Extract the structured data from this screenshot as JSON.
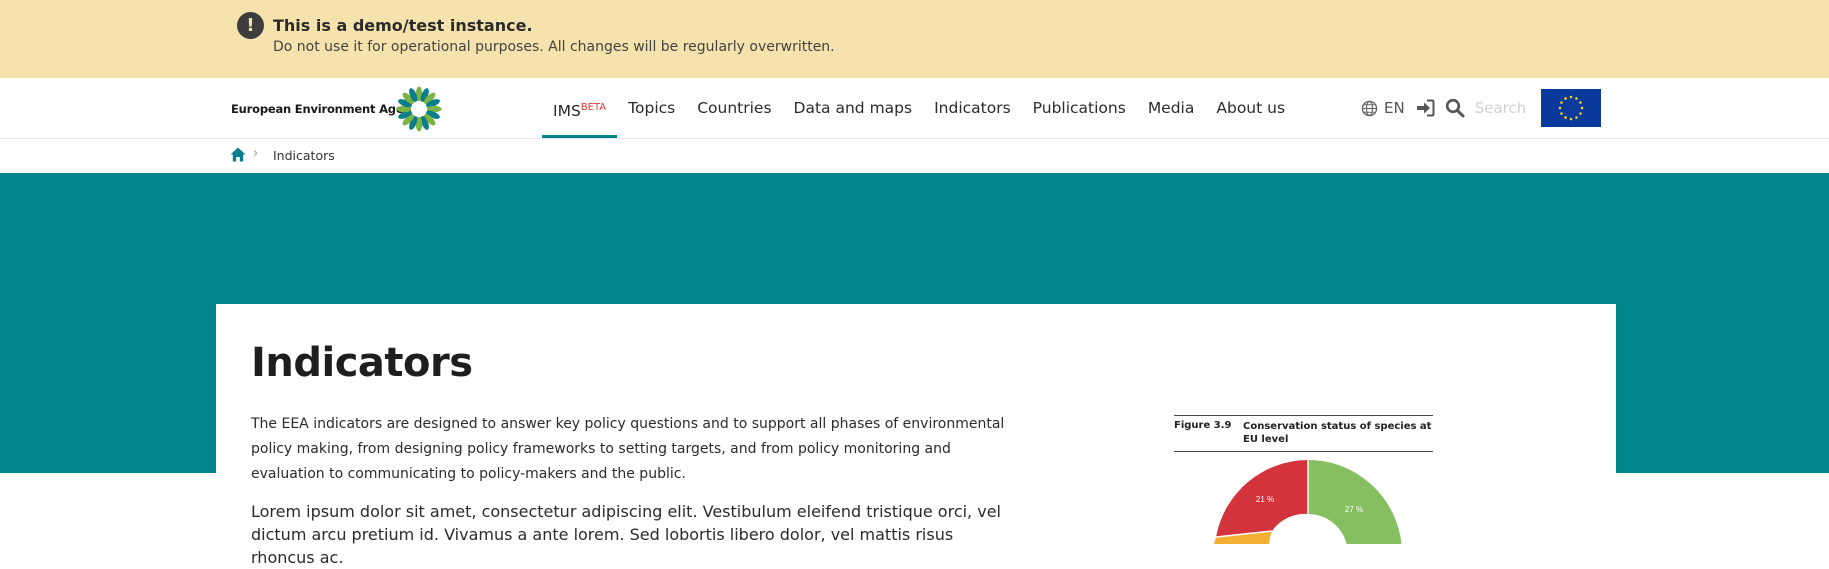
{
  "banner": {
    "title": "This is a demo/test instance.",
    "message": "Do not use it for operational purposes. All changes will be regularly overwritten.",
    "icon": "exclamation-circle-icon"
  },
  "header": {
    "logo_text": "European Environment Agency",
    "nav": [
      {
        "label": "IMS",
        "sup": "BETA",
        "active": true
      },
      {
        "label": "Topics"
      },
      {
        "label": "Countries"
      },
      {
        "label": "Data and maps"
      },
      {
        "label": "Indicators"
      },
      {
        "label": "Publications"
      },
      {
        "label": "Media"
      },
      {
        "label": "About us"
      }
    ],
    "language": "EN",
    "search_placeholder": "Search"
  },
  "breadcrumb": {
    "current": "Indicators"
  },
  "main": {
    "title": "Indicators",
    "intro": "The EEA indicators are designed to answer key policy questions and to support all phases of environmental policy making, from designing policy frameworks to setting targets, and from policy monitoring and evaluation to communicating to policy-makers and the public.",
    "lorem": "Lorem ipsum dolor sit amet, consectetur adipiscing elit. Vestibulum eleifend tristique orci, vel dictum arcu pretium id. Vivamus a ante lorem. Sed lobortis libero dolor, vel mattis risus rhoncus ac."
  },
  "figure": {
    "number": "Figure 3.9",
    "title": "Conservation status of species at EU level",
    "slices": [
      {
        "label": "27 %",
        "color": "#86bf5f"
      },
      {
        "label": "21 %",
        "color": "#d3333a"
      },
      {
        "label": "",
        "color": "#f2b033"
      }
    ]
  },
  "colors": {
    "teal": "#00868b",
    "banner": "#f5e2ac",
    "beta": "#e0362e",
    "eu_blue": "#0c3a9c"
  }
}
